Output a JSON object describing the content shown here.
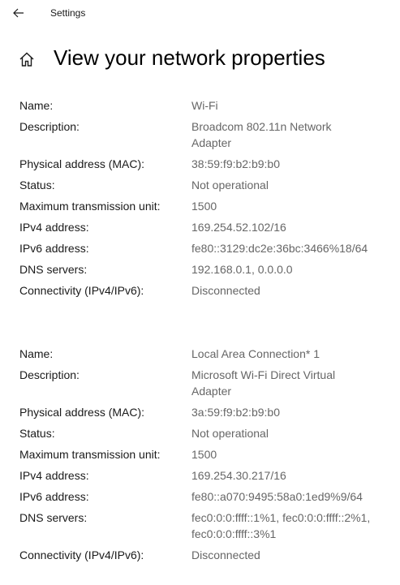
{
  "window": {
    "title": "Settings"
  },
  "page": {
    "title": "View your network properties"
  },
  "adapters": [
    {
      "rows": [
        {
          "label": "Name:",
          "value": "Wi-Fi"
        },
        {
          "label": "Description:",
          "value": "Broadcom 802.11n Network Adapter"
        },
        {
          "label": "Physical address (MAC):",
          "value": "38:59:f9:b2:b9:b0"
        },
        {
          "label": "Status:",
          "value": "Not operational"
        },
        {
          "label": "Maximum transmission unit:",
          "value": "1500"
        },
        {
          "label": "IPv4 address:",
          "value": "169.254.52.102/16"
        },
        {
          "label": "IPv6 address:",
          "value": "fe80::3129:dc2e:36bc:3466%18/64"
        },
        {
          "label": "DNS servers:",
          "value": "192.168.0.1, 0.0.0.0"
        },
        {
          "label": "Connectivity (IPv4/IPv6):",
          "value": "Disconnected"
        }
      ]
    },
    {
      "rows": [
        {
          "label": "Name:",
          "value": "Local Area Connection* 1"
        },
        {
          "label": "Description:",
          "value": "Microsoft Wi-Fi Direct Virtual Adapter"
        },
        {
          "label": "Physical address (MAC):",
          "value": "3a:59:f9:b2:b9:b0"
        },
        {
          "label": "Status:",
          "value": "Not operational"
        },
        {
          "label": "Maximum transmission unit:",
          "value": "1500"
        },
        {
          "label": "IPv4 address:",
          "value": "169.254.30.217/16"
        },
        {
          "label": "IPv6 address:",
          "value": "fe80::a070:9495:58a0:1ed9%9/64"
        },
        {
          "label": "DNS servers:",
          "value": "fec0:0:0:ffff::1%1, fec0:0:0:ffff::2%1, fec0:0:0:ffff::3%1"
        },
        {
          "label": "Connectivity (IPv4/IPv6):",
          "value": "Disconnected"
        }
      ]
    }
  ]
}
